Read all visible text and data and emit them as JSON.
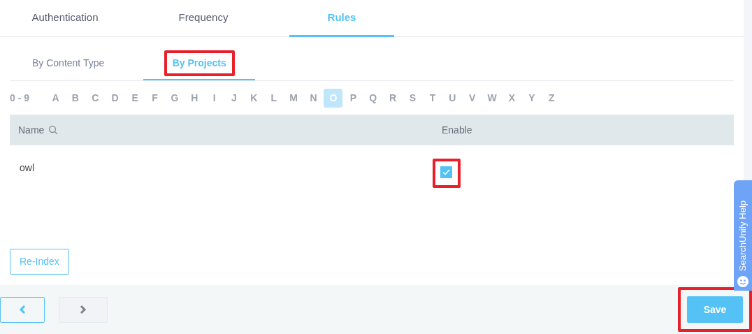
{
  "tabs": [
    {
      "label": "Authentication",
      "selected": false
    },
    {
      "label": "Frequency",
      "selected": false
    },
    {
      "label": "Rules",
      "selected": true
    }
  ],
  "sub_tabs": [
    {
      "label": "By Content Type",
      "selected": false,
      "highlighted": false
    },
    {
      "label": "By Projects",
      "selected": true,
      "highlighted": true
    }
  ],
  "letters": [
    {
      "label": "0 - 9",
      "selected": false
    },
    {
      "label": "A",
      "selected": false
    },
    {
      "label": "B",
      "selected": false
    },
    {
      "label": "C",
      "selected": false
    },
    {
      "label": "D",
      "selected": false
    },
    {
      "label": "E",
      "selected": false
    },
    {
      "label": "F",
      "selected": false
    },
    {
      "label": "G",
      "selected": false
    },
    {
      "label": "H",
      "selected": false
    },
    {
      "label": "I",
      "selected": false
    },
    {
      "label": "J",
      "selected": false
    },
    {
      "label": "K",
      "selected": false
    },
    {
      "label": "L",
      "selected": false
    },
    {
      "label": "M",
      "selected": false
    },
    {
      "label": "N",
      "selected": false
    },
    {
      "label": "O",
      "selected": true
    },
    {
      "label": "P",
      "selected": false
    },
    {
      "label": "Q",
      "selected": false
    },
    {
      "label": "R",
      "selected": false
    },
    {
      "label": "S",
      "selected": false
    },
    {
      "label": "T",
      "selected": false
    },
    {
      "label": "U",
      "selected": false
    },
    {
      "label": "V",
      "selected": false
    },
    {
      "label": "W",
      "selected": false
    },
    {
      "label": "X",
      "selected": false
    },
    {
      "label": "Y",
      "selected": false
    },
    {
      "label": "Z",
      "selected": false
    }
  ],
  "table": {
    "columns": [
      "Name",
      "Enable"
    ],
    "rows": [
      {
        "name": "owl",
        "enabled": true,
        "highlighted": true
      }
    ]
  },
  "reindex_button": "Re-Index",
  "save_button": {
    "label": "Save",
    "highlighted": true
  },
  "help_tab": "SearchUnify Help"
}
